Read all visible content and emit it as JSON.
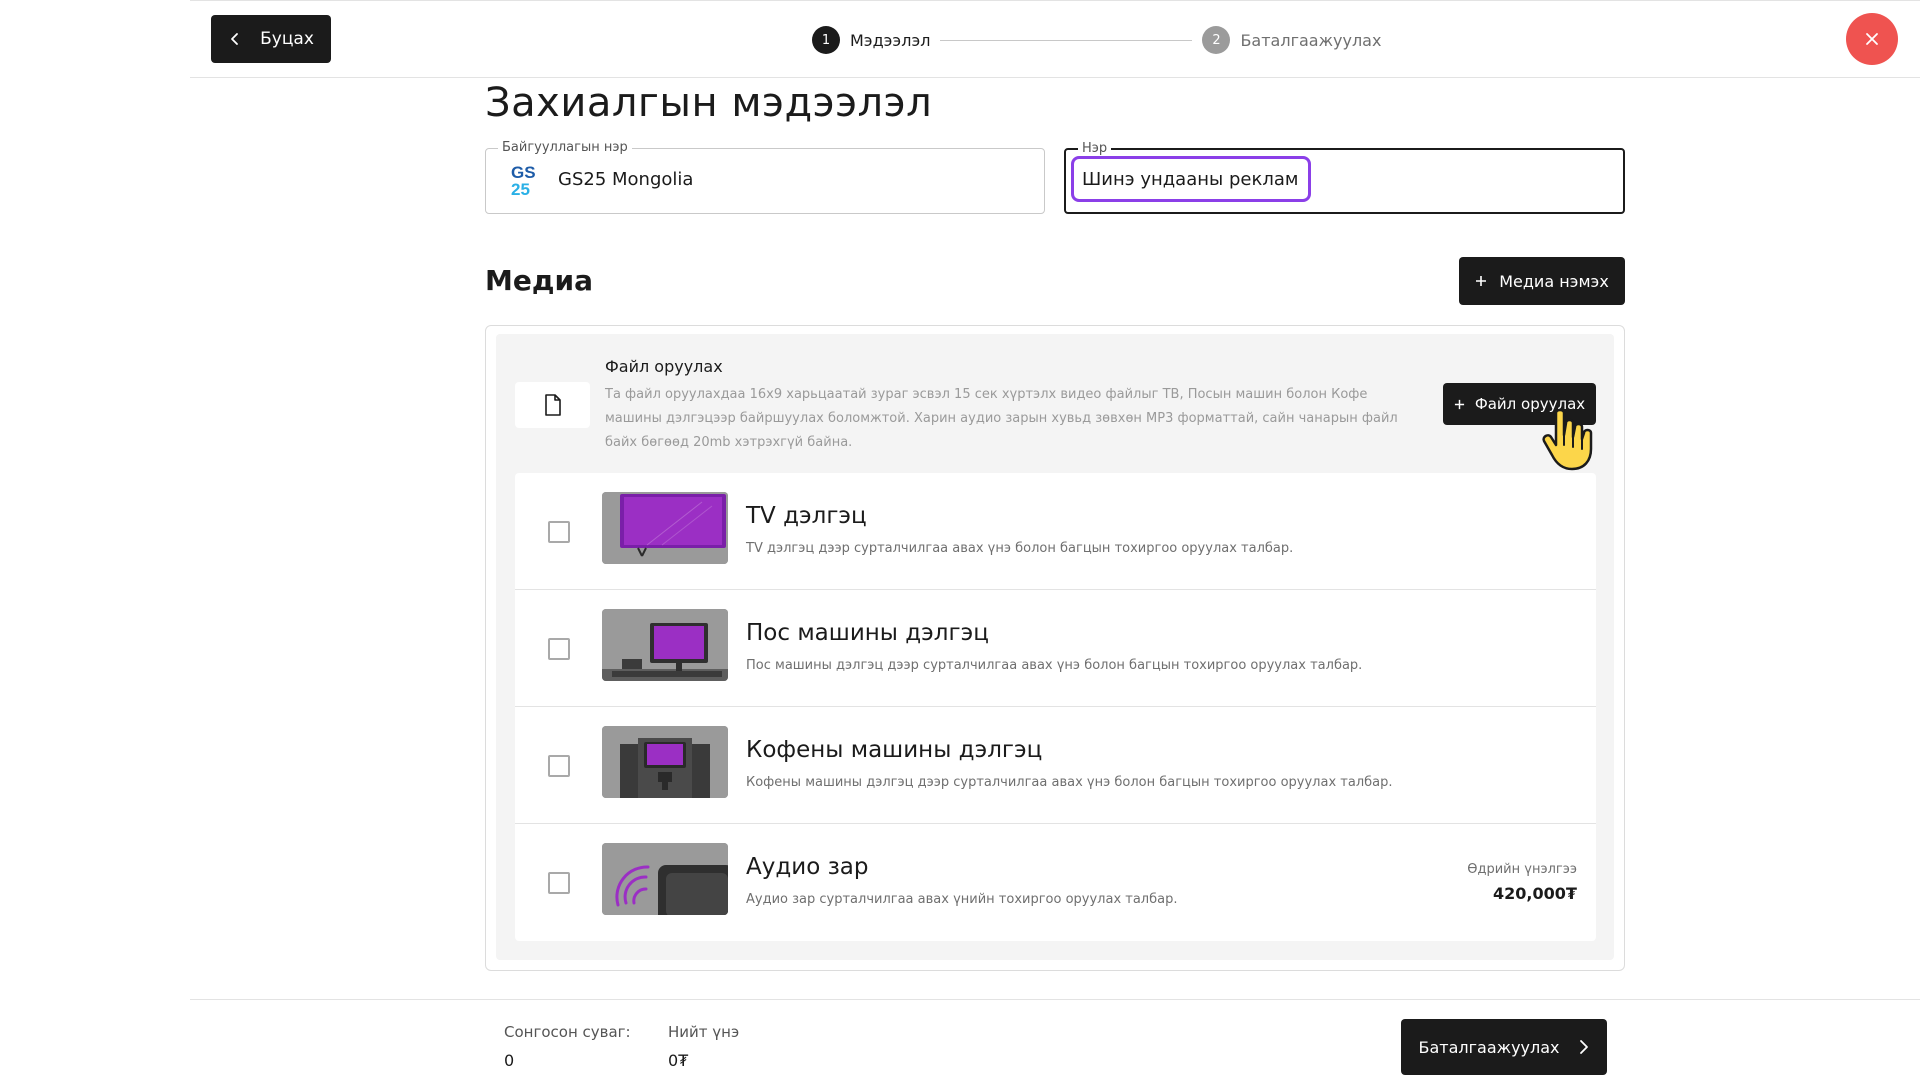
{
  "header": {
    "back_label": "Буцах",
    "steps": [
      {
        "num": "1",
        "label": "Мэдээлэл",
        "state": "active"
      },
      {
        "num": "2",
        "label": "Баталгаажуулах",
        "state": "inactive"
      }
    ],
    "close_color": "#ef5350"
  },
  "page": {
    "title": "Захиалгын мэдээлэл"
  },
  "form": {
    "org_legend": "Байгууллагын нэр",
    "org_logo_line1": "GS",
    "org_logo_line2": "25",
    "org_value": "GS25 Mongolia",
    "name_legend": "Нэр",
    "name_value": "Шинэ ундааны реклам",
    "accent_color": "#8b3fe8"
  },
  "media": {
    "section_title": "Медиа",
    "add_media_label": "Медиа нэмэх",
    "upload": {
      "title": "Файл оруулах",
      "description": "Та файл оруулахдаа 16x9 харьцаатай зураг эсвэл 15 сек хүртэлх видео файлыг ТВ, Посын машин болон Кофе машины дэлгэцээр байршуулах боломжтой. Харин аудио зарын хувьд зөвхөн MP3 форматтай, сайн чанарын файл байх бөгөөд 20mb хэтрэхгүй байна.",
      "button_label": "Файл оруулах"
    },
    "items": [
      {
        "title": "TV дэлгэц",
        "desc": "TV дэлгэц дээр сурталчилгаа авах үнэ болон багцын тохиргоо оруулах талбар.",
        "icon": "tv-thumbnail",
        "checked": false
      },
      {
        "title": "Пос машины дэлгэц",
        "desc": "Пос машины дэлгэц дээр сурталчилгаа авах үнэ болон багцын тохиргоо оруулах талбар.",
        "icon": "pos-thumbnail",
        "checked": false
      },
      {
        "title": "Кофены машины дэлгэц",
        "desc": "Кофены машины дэлгэц дээр сурталчилгаа авах үнэ болон багцын тохиргоо оруулах талбар.",
        "icon": "coffee-machine-thumbnail",
        "checked": false
      },
      {
        "title": "Аудио зар",
        "desc": "Аудио зар сурталчилгаа авах үнийн тохиргоо оруулах талбар.",
        "icon": "audio-thumbnail",
        "checked": false,
        "price_label": "Өдрийн үнэлгээ",
        "price_value": "420,000₮"
      }
    ]
  },
  "footer": {
    "selected_label": "Сонгосон суваг:",
    "selected_value": "0",
    "total_label": "Нийт үнэ",
    "total_value": "0₮",
    "confirm_label": "Баталгаажуулах"
  }
}
